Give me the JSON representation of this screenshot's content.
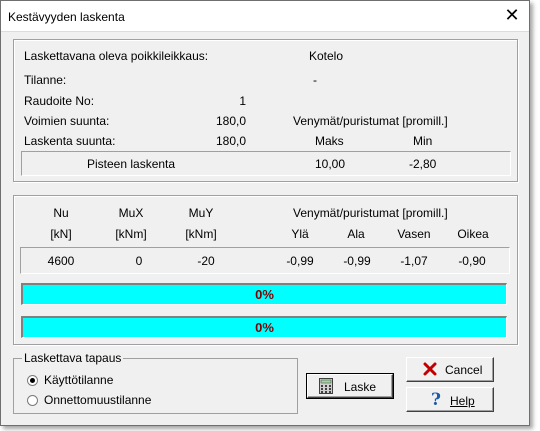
{
  "window": {
    "title": "Kestävyyden laskenta",
    "close_glyph": "✕"
  },
  "top": {
    "section_label": "Laskettavana oleva poikkileikkaus:",
    "section_value": "Kotelo",
    "tilanne_label": "Tilanne:",
    "tilanne_value": "-",
    "raudoite_label": "Raudoite No:",
    "raudoite_value": "1",
    "voimien_label": "Voimien suunta:",
    "voimien_value": "180,0",
    "laskenta_label": "Laskenta suunta:",
    "laskenta_value": "180,0",
    "strain_header": "Venymät/puristumat  [promill.]",
    "maks_label": "Maks",
    "min_label": "Min",
    "point_label": "Pisteen laskenta",
    "maks_value": "10,00",
    "min_value": "-2,80"
  },
  "results": {
    "headers": [
      "Nu",
      "MuX",
      "MuY"
    ],
    "units": [
      "[kN]",
      "[kNm]",
      "[kNm]"
    ],
    "strain_header": "Venymät/puristumat  [promill.]",
    "strain_columns": [
      "Ylä",
      "Ala",
      "Vasen",
      "Oikea"
    ],
    "values": [
      "4600",
      "0",
      "-20",
      "-0,99",
      "-0,99",
      "-1,07",
      "-0,90"
    ],
    "progress1_text": "0%",
    "progress1_value": 0,
    "progress2_text": "0%",
    "progress2_value": 0
  },
  "case_group": {
    "title": "Laskettava tapaus",
    "option1": "Käyttötilanne",
    "option2": "Onnettomuustilanne",
    "selected": "Käyttötilanne"
  },
  "buttons": {
    "laske": "Laske",
    "cancel": "Cancel",
    "help": "Help"
  },
  "icons": {
    "laske": "calculator-icon",
    "cancel": "red-x-icon",
    "help": "question-mark-icon"
  },
  "colors": {
    "progress": "#00ffff",
    "progress_text": "#800000",
    "cancel_x": "#c00000",
    "help_q": "#1e5aa8"
  }
}
